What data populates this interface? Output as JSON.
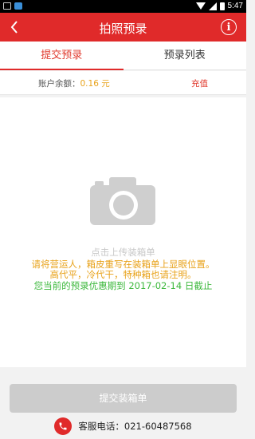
{
  "status_bar": {
    "time": "5:47"
  },
  "header": {
    "title": "拍照预录"
  },
  "tabs": [
    {
      "label": "提交预录",
      "active": true
    },
    {
      "label": "预录列表",
      "active": false
    }
  ],
  "balance": {
    "label": "账户余额：",
    "value": "0.16 元",
    "recharge_label": "充值"
  },
  "upload": {
    "hint": "点击上传装箱单",
    "notice_line1": "请将营运人，箱皮重写在装箱单上显眼位置。",
    "notice_line2": "高代平，冷代干，特种箱也请注明。",
    "promo": "您当前的预录优惠期到 2017-02-14 日截止"
  },
  "submit": {
    "label": "提交装箱单"
  },
  "hotline": {
    "text": "客服电话：021-60487568"
  },
  "colors": {
    "primary": "#e02a2a",
    "warning": "#e8a21a",
    "success": "#3cb83c",
    "disabled": "#cccccc"
  },
  "icons": [
    "back-arrow-icon",
    "info-icon",
    "camera-icon",
    "phone-icon"
  ]
}
